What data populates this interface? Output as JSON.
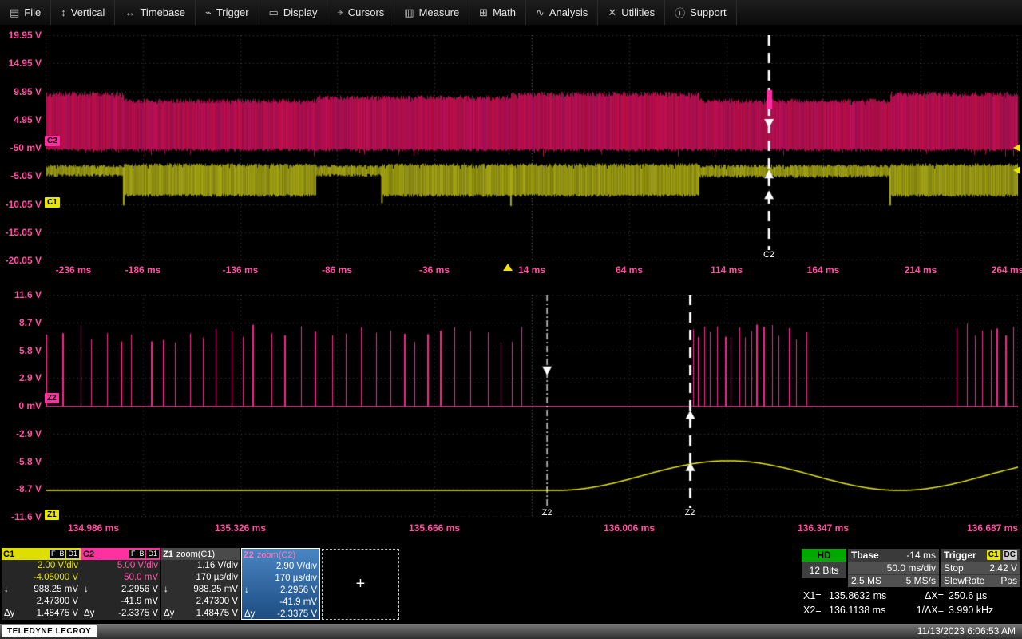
{
  "menu": {
    "items": [
      {
        "label": "File",
        "icon": "file-icon",
        "glyph": "▤"
      },
      {
        "label": "Vertical",
        "icon": "vertical-icon",
        "glyph": "↕"
      },
      {
        "label": "Timebase",
        "icon": "timebase-icon",
        "glyph": "↔"
      },
      {
        "label": "Trigger",
        "icon": "trigger-icon",
        "glyph": "⌁"
      },
      {
        "label": "Display",
        "icon": "display-icon",
        "glyph": "▭"
      },
      {
        "label": "Cursors",
        "icon": "cursors-icon",
        "glyph": "⌖"
      },
      {
        "label": "Measure",
        "icon": "measure-icon",
        "glyph": "▥"
      },
      {
        "label": "Math",
        "icon": "math-icon",
        "glyph": "⊞"
      },
      {
        "label": "Analysis",
        "icon": "analysis-icon",
        "glyph": "∿"
      },
      {
        "label": "Utilities",
        "icon": "utilities-icon",
        "glyph": "✕"
      },
      {
        "label": "Support",
        "icon": "support-icon",
        "glyph": "ⓘ"
      }
    ]
  },
  "plot1": {
    "y_labels": [
      "19.95 V",
      "14.95 V",
      "9.95 V",
      "4.95 V",
      "-50 mV",
      "-5.05 V",
      "-10.05 V",
      "-15.05 V",
      "-20.05 V"
    ],
    "x_labels": [
      "-236 ms",
      "-186 ms",
      "-136 ms",
      "-86 ms",
      "-36 ms",
      "14 ms",
      "64 ms",
      "114 ms",
      "164 ms",
      "214 ms",
      "264 ms"
    ],
    "badge_c2": "C2",
    "badge_c1": "C1",
    "cursor_label": "C2"
  },
  "plot2": {
    "y_labels": [
      "11.6 V",
      "8.7 V",
      "5.8 V",
      "2.9 V",
      "0 mV",
      "-2.9 V",
      "-5.8 V",
      "-8.7 V",
      "-11.6 V"
    ],
    "x_labels": [
      "134.986 ms",
      "135.326 ms",
      "135.666 ms",
      "136.006 ms",
      "136.347 ms",
      "136.687 ms"
    ],
    "badge_z2": "Z2",
    "badge_z1": "Z1",
    "cursor1_label": "Z2",
    "cursor2_label": "Z2"
  },
  "chart_data": [
    {
      "type": "line",
      "title": "main-grid",
      "x_unit": "ms",
      "y_unit": "V",
      "x_range": [
        -236,
        264
      ],
      "y_range": [
        -20.05,
        19.95
      ],
      "x_div": "50 ms/div",
      "y_div": "5 V/div",
      "grid": "dotted",
      "series": [
        {
          "name": "C2",
          "color": "#a01460",
          "style": "noise-band",
          "segments": [
            {
              "t0": -236,
              "t1": -196,
              "top": 9.9,
              "bot": -0.3
            },
            {
              "t0": -196,
              "t1": -97,
              "top": 8.7,
              "bot": -0.3
            },
            {
              "t0": -97,
              "t1": 3,
              "top": 9.3,
              "bot": -0.3
            },
            {
              "t0": 3,
              "t1": 100,
              "top": 9.9,
              "bot": -0.3
            },
            {
              "t0": 100,
              "t1": 198,
              "top": 8.7,
              "bot": -0.3
            },
            {
              "t0": 198,
              "t1": 264,
              "top": 9.9,
              "bot": -0.3
            }
          ]
        },
        {
          "name": "C1",
          "color": "#8f8f12",
          "style": "noise-band",
          "segments": [
            {
              "t0": -236,
              "t1": -196,
              "top": -3.0,
              "bot": -5.2
            },
            {
              "t0": -196,
              "t1": -97,
              "top": -2.8,
              "bot": -8.8
            },
            {
              "t0": -97,
              "t1": -63,
              "top": -3.0,
              "bot": -5.2
            },
            {
              "t0": -63,
              "t1": 100,
              "top": -2.8,
              "bot": -8.8
            },
            {
              "t0": 100,
              "t1": 198,
              "top": -3.0,
              "bot": -5.4
            },
            {
              "t0": 198,
              "t1": 264,
              "top": -2.8,
              "bot": -8.8
            }
          ],
          "spikes": [
            {
              "t": -195.8,
              "v": -10.3
            },
            {
              "t": -63,
              "v": -9.9
            },
            {
              "t": 3.3,
              "v": -10.4
            },
            {
              "t": 198.3,
              "v": -10.3
            }
          ]
        }
      ],
      "cursors": [
        {
          "label": "C2",
          "t": 135.99,
          "style": "bold",
          "arrows": [
            {
              "v": 3.5,
              "dir": "down"
            },
            {
              "v": -3.9,
              "dir": "up"
            },
            {
              "v": -7.6,
              "dir": "up"
            }
          ]
        }
      ],
      "marker": {
        "t": 135.99,
        "v0": 10.2,
        "v1": 6.8,
        "color": "#ff2da0"
      }
    },
    {
      "type": "line",
      "title": "zoom-grid",
      "x_unit": "ms",
      "y_unit": "V",
      "x_range": [
        134.986,
        136.687
      ],
      "y_range": [
        -11.6,
        11.6
      ],
      "x_div": "170 µs/div",
      "y_div": "2.9 V/div",
      "grid": "dotted",
      "series": [
        {
          "name": "Z2",
          "color": "#ff2090",
          "style": "pulse-train",
          "baseline": 0,
          "groups": [
            {
              "t0": 134.986,
              "t1": 135.828,
              "pitch": 0.026,
              "hmin": 6.6,
              "hmax": 8.6
            },
            {
              "t0": 136.118,
              "t1": 136.326,
              "pitch": 0.013,
              "hmin": 6.8,
              "hmax": 8.6
            },
            {
              "t0": 136.58,
              "t1": 136.687,
              "pitch": 0.013,
              "hmin": 6.8,
              "hmax": 8.6
            }
          ]
        },
        {
          "name": "Z1",
          "color": "#e8e810",
          "style": "flat-then-sine",
          "flat_v": -8.85,
          "t_start": 135.88,
          "center": -7.3,
          "amp": 1.55,
          "period": 0.6
        }
      ],
      "cursors": [
        {
          "label": "Z2",
          "t": 135.8632,
          "style": "thin",
          "arrows": [
            {
              "v": 3.2,
              "dir": "down"
            }
          ]
        },
        {
          "label": "Z2",
          "t": 136.1138,
          "style": "bold",
          "arrows": [
            {
              "v": -0.45,
              "dir": "up"
            },
            {
              "v": -5.9,
              "dir": "up"
            }
          ]
        }
      ]
    }
  ],
  "descriptors": {
    "c1": {
      "title": "C1",
      "badges": [
        "F",
        "B",
        "D1"
      ],
      "rows": [
        {
          "p": "",
          "v": "2.00 V/div"
        },
        {
          "p": "",
          "v": "-4.05000 V"
        },
        {
          "p": "↓",
          "v": "988.25 mV"
        },
        {
          "p": "",
          "v": "2.47300 V"
        },
        {
          "p": "Δy",
          "v": "1.48475 V"
        }
      ]
    },
    "c2": {
      "title": "C2",
      "badges": [
        "F",
        "B",
        "D1"
      ],
      "rows": [
        {
          "p": "",
          "v": "5.00 V/div"
        },
        {
          "p": "",
          "v": "50.0 mV"
        },
        {
          "p": "↓",
          "v": "2.2956 V"
        },
        {
          "p": "",
          "v": "-41.9 mV"
        },
        {
          "p": "Δy",
          "v": "-2.3375 V"
        }
      ]
    },
    "z1": {
      "title": "Z1",
      "subtitle": "zoom(C1)",
      "rows": [
        {
          "p": "",
          "v": "1.16 V/div"
        },
        {
          "p": "",
          "v": "170 µs/div"
        },
        {
          "p": "↓",
          "v": "988.25 mV"
        },
        {
          "p": "",
          "v": "2.47300 V"
        },
        {
          "p": "Δy",
          "v": "1.48475 V"
        }
      ]
    },
    "z2": {
      "title": "Z2",
      "subtitle": "zoom(C2)",
      "rows": [
        {
          "p": "",
          "v": "2.90 V/div"
        },
        {
          "p": "",
          "v": "170 µs/div"
        },
        {
          "p": "↓",
          "v": "2.2956 V"
        },
        {
          "p": "",
          "v": "-41.9 mV"
        },
        {
          "p": "Δy",
          "v": "-2.3375 V"
        }
      ]
    },
    "add_label": "+"
  },
  "right_panel": {
    "hd": {
      "label": "HD",
      "bits": "12 Bits"
    },
    "tbase": {
      "label": "Tbase",
      "offset": "-14 ms",
      "scale": "50.0 ms/div",
      "samples": "2.5 MS",
      "rate": "5 MS/s"
    },
    "trigger": {
      "label": "Trigger",
      "source": "C1",
      "coupling": "DC",
      "mode": "Stop",
      "level": "2.42 V",
      "type": "SlewRate",
      "slope": "Pos"
    },
    "cursors": {
      "x1_label": "X1=",
      "x1": "135.8632 ms",
      "dx_label": "ΔX=",
      "dx": "250.6 µs",
      "x2_label": "X2=",
      "x2": "136.1138 ms",
      "invdx_label": "1/ΔX=",
      "invdx": "3.990 kHz"
    }
  },
  "status_bar": {
    "brand": "TELEDYNE LECROY",
    "datetime": "11/13/2023 6:06:53 AM"
  },
  "colors": {
    "c1": "#e6e600",
    "c2": "#ff30a0",
    "z1": "#e8e810",
    "z2": "#ff2090",
    "axis_text": "#ff4fa0",
    "hd_green": "#00a800",
    "selected_blue": "#2d6aa8"
  }
}
